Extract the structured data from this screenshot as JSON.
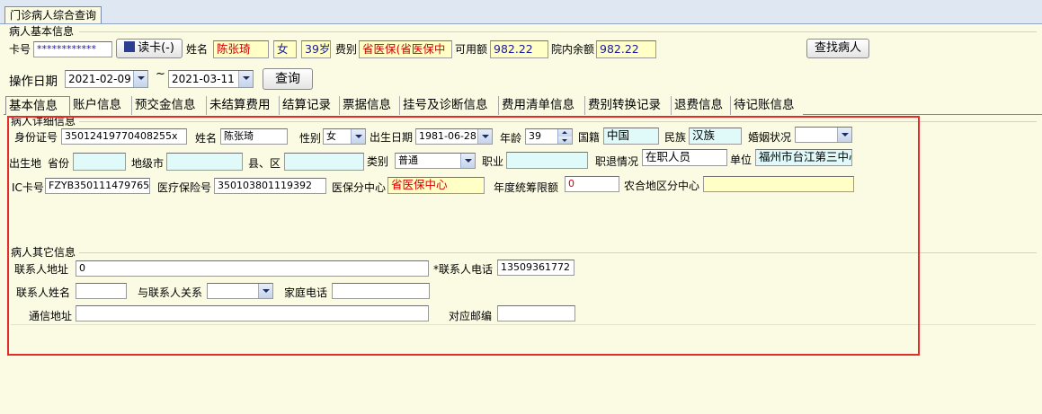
{
  "window_tab": "门诊病人综合查询",
  "basic_group": {
    "title": "病人基本信息",
    "card_no_label": "卡号",
    "card_no_value": "************",
    "read_card_button": "读卡(-)",
    "name_label": "姓名",
    "name_value": "陈张琦",
    "gender_value": "女",
    "age_value": "39岁",
    "fee_type_label": "费别",
    "fee_type_value": "省医保(省医保中",
    "available_label": "可用额",
    "available_value": "982.22",
    "hospital_balance_label": "院内余额",
    "hospital_balance_value": "982.22",
    "find_patient_button": "查找病人"
  },
  "operation": {
    "date_label": "操作日期",
    "start_date": "2021-02-09",
    "separator": "~",
    "end_date": "2021-03-11",
    "query_button": "查询"
  },
  "tabs": [
    {
      "label": "基本信息",
      "active": true
    },
    {
      "label": "账户信息",
      "active": false
    },
    {
      "label": "预交金信息",
      "active": false
    },
    {
      "label": "未结算费用",
      "active": false
    },
    {
      "label": "结算记录",
      "active": false
    },
    {
      "label": "票据信息",
      "active": false
    },
    {
      "label": "挂号及诊断信息",
      "active": false
    },
    {
      "label": "费用清单信息",
      "active": false
    },
    {
      "label": "费别转换记录",
      "active": false
    },
    {
      "label": "退费信息",
      "active": false
    },
    {
      "label": "待记账信息",
      "active": false
    }
  ],
  "detail": {
    "title": "病人详细信息",
    "id_label": "身份证号",
    "id_value": "35012419770408255x",
    "name_label": "姓名",
    "name_value": "陈张琦",
    "gender_label": "性别",
    "gender_value": "女",
    "birth_label": "出生日期",
    "birth_value": "1981-06-28",
    "age_label": "年龄",
    "age_value": "39",
    "nationality_label": "国籍",
    "nationality_value": "中国",
    "ethnicity_label": "民族",
    "ethnicity_value": "汉族",
    "marital_label": "婚姻状况",
    "marital_value": "",
    "birthplace_label": "出生地",
    "province_label": "省份",
    "province_value": "",
    "city_label": "地级市",
    "city_value": "",
    "county_label": "县、区",
    "county_value": "",
    "category_label": "类别",
    "category_value": "普通",
    "occupation_label": "职业",
    "occupation_value": "",
    "retire_label": "职退情况",
    "retire_value": "在职人员",
    "unit_label": "单位",
    "unit_value": "福州市台江第三中心",
    "ic_label": "IC卡号",
    "ic_value": "FZYB350111479765",
    "insurance_label": "医疗保险号",
    "insurance_value": "350103801119392",
    "center_label": "医保分中心",
    "center_value": "省医保中心",
    "annual_label": "年度统筹限额",
    "annual_value": "0",
    "rural_label": "农合地区分中心",
    "rural_value": ""
  },
  "other": {
    "title": "病人其它信息",
    "contact_address_label": "联系人地址",
    "contact_address_value": "0",
    "contact_phone_label": "*联系人电话",
    "contact_phone_value": "13509361772",
    "contact_name_label": "联系人姓名",
    "contact_name_value": "",
    "relation_label": "与联系人关系",
    "relation_value": "",
    "home_phone_label": "家庭电话",
    "home_phone_value": "",
    "mail_address_label": "通信地址",
    "mail_address_value": "",
    "postcode_label": "对应邮编",
    "postcode_value": ""
  },
  "colors": {
    "background": "#fbfbe3",
    "highlight_frame": "#e42c2c",
    "readonly_cyan": "#e0fafa",
    "readonly_yellow": "#ffffc6"
  }
}
